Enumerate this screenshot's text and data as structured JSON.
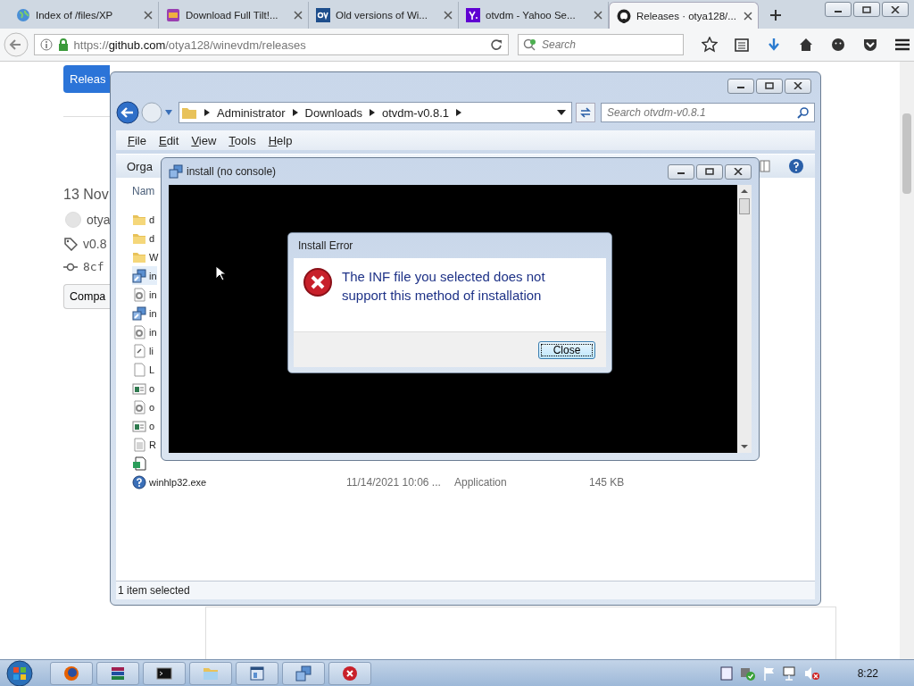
{
  "browser": {
    "tabs": [
      {
        "title": "Index of /files/XP",
        "selected": false,
        "kind": "globe"
      },
      {
        "title": "Download Full Tilt!...",
        "selected": false,
        "kind": "game"
      },
      {
        "title": "Old versions of Wi...",
        "selected": false,
        "kind": "ov"
      },
      {
        "title": "otvdm - Yahoo Se...",
        "selected": false,
        "kind": "yahoo"
      },
      {
        "title": "Releases · otya128/...",
        "selected": true,
        "kind": "octocat"
      }
    ],
    "url": "https://**github.com**/otya128/winevdm/releases",
    "search_placeholder": "Search"
  },
  "page": {
    "release_button": "Releas",
    "date": "13 Nov",
    "author": "otya",
    "tag": "v0.8",
    "commit": "8cf",
    "compare_button": "Compa"
  },
  "explorer": {
    "breadcrumbs": [
      "Administrator",
      "Downloads",
      "otvdm-v0.8.1"
    ],
    "search_placeholder": "Search otvdm-v0.8.1",
    "menu": [
      "File",
      "Edit",
      "View",
      "Tools",
      "Help"
    ],
    "organize": "Orga",
    "column": "Nam",
    "files": [
      {
        "kind": "folder",
        "name": "d"
      },
      {
        "kind": "folder",
        "name": "d"
      },
      {
        "kind": "folder",
        "name": "W"
      },
      {
        "kind": "setup",
        "name": "in",
        "selected": true
      },
      {
        "kind": "config",
        "name": "in",
        "selected": false
      },
      {
        "kind": "setup",
        "name": "in",
        "selected": false
      },
      {
        "kind": "config",
        "name": "in",
        "selected": false
      },
      {
        "kind": "link",
        "name": "li",
        "selected": false
      },
      {
        "kind": "blank",
        "name": "L",
        "selected": false
      },
      {
        "kind": "window",
        "name": "o",
        "selected": false
      },
      {
        "kind": "config",
        "name": "o",
        "selected": false
      },
      {
        "kind": "window",
        "name": "o",
        "selected": false
      },
      {
        "kind": "text",
        "name": "R",
        "selected": false
      },
      {
        "kind": "reg",
        "selected": false
      },
      {
        "kind": "help",
        "name": "winhlp32.exe",
        "date": "11/14/2021 10:06 ...",
        "type": "Application",
        "size": "145 KB",
        "selected": false
      }
    ],
    "status": "1 item selected"
  },
  "console": {
    "title": "install (no console)"
  },
  "dialog": {
    "title": "Install Error",
    "message": "The INF file you selected does not support this method of installation",
    "button": "Close"
  },
  "taskbar": {
    "apps": [
      {
        "kind": "firefox"
      },
      {
        "kind": "archive"
      },
      {
        "kind": "terminal"
      },
      {
        "kind": "folder"
      },
      {
        "kind": "app"
      },
      {
        "kind": "setup"
      },
      {
        "kind": "error"
      }
    ],
    "clock": "8:22"
  }
}
